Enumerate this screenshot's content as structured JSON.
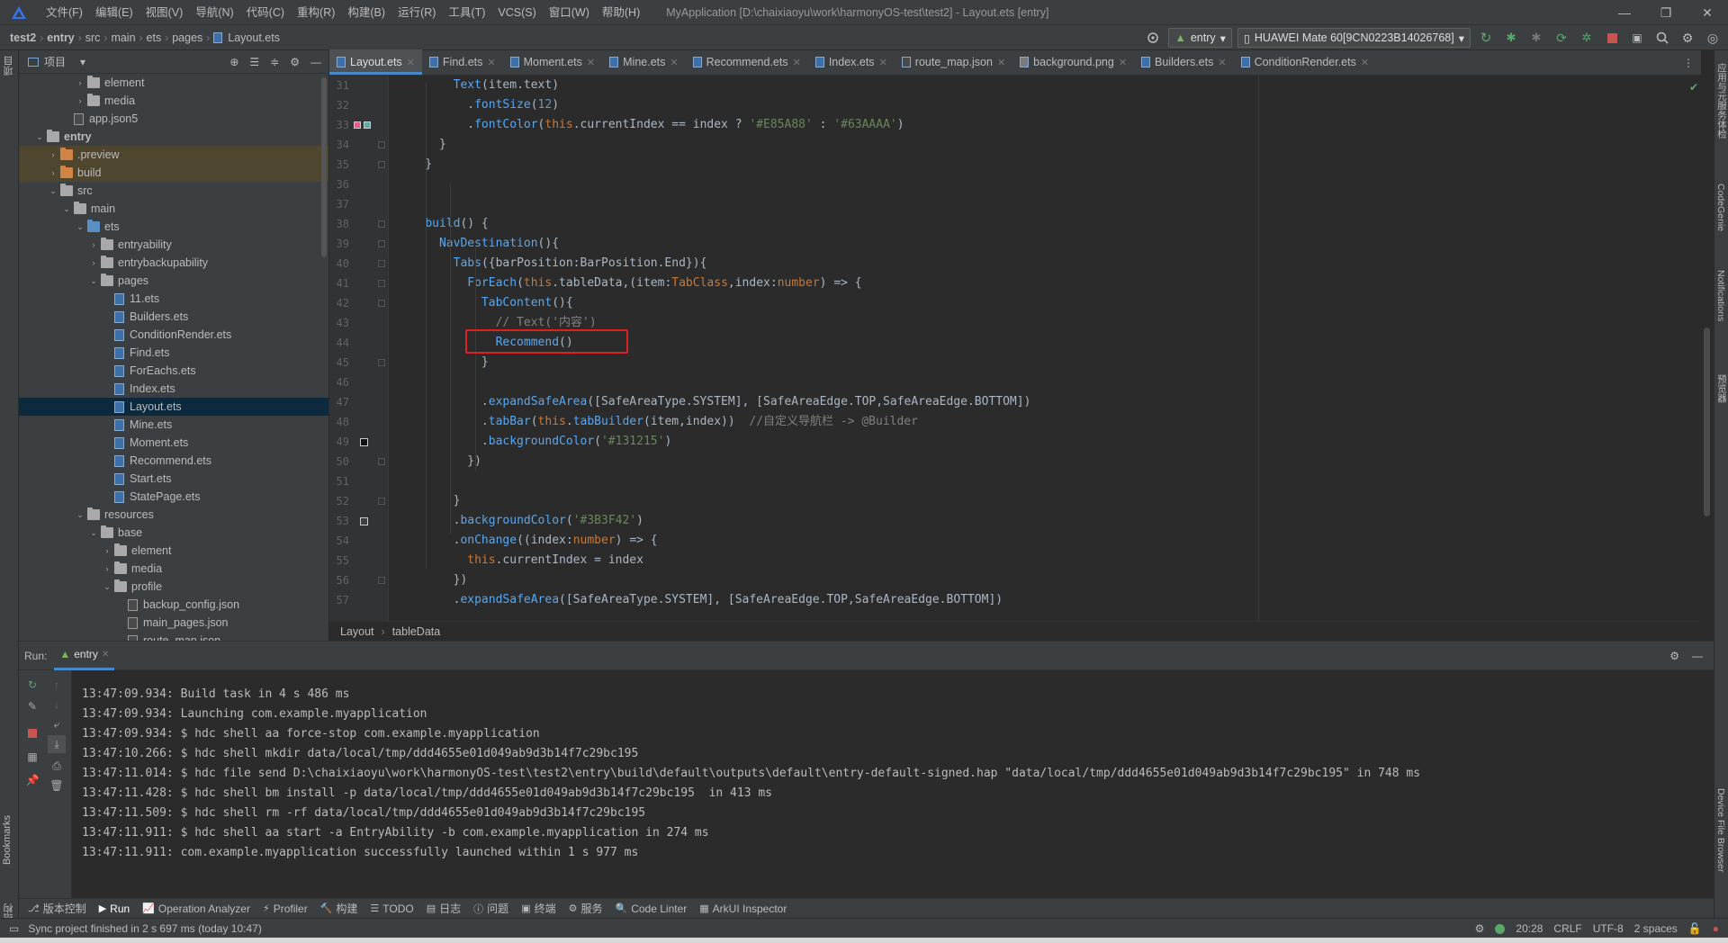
{
  "menubar": {
    "items": [
      "文件(F)",
      "编辑(E)",
      "视图(V)",
      "导航(N)",
      "代码(C)",
      "重构(R)",
      "构建(B)",
      "运行(R)",
      "工具(T)",
      "VCS(S)",
      "窗口(W)",
      "帮助(H)"
    ],
    "window_title": "MyApplication [D:\\chaixiaoyu\\work\\harmonyOS-test\\test2] - Layout.ets [entry]"
  },
  "navbar": {
    "breadcrumbs": [
      "test2",
      "entry",
      "src",
      "main",
      "ets",
      "pages",
      "Layout.ets"
    ],
    "run_config": "entry",
    "device": "HUAWEI Mate 60[9CN0223B14026768]"
  },
  "left_strip": {
    "project_label": "项目",
    "bookmarks_label": "Bookmarks",
    "structure_label": "结构"
  },
  "project": {
    "header_label": "项目",
    "tree": [
      {
        "label": "element",
        "depth": 4,
        "type": "folder",
        "arrow": "›"
      },
      {
        "label": "media",
        "depth": 4,
        "type": "folder",
        "arrow": "›"
      },
      {
        "label": "app.json5",
        "depth": 3,
        "type": "json",
        "arrow": ""
      },
      {
        "label": "entry",
        "depth": 1,
        "type": "folder-mod",
        "arrow": "⌄",
        "bold": true
      },
      {
        "label": ".preview",
        "depth": 2,
        "type": "folder-orange",
        "arrow": "›",
        "excluded": true
      },
      {
        "label": "build",
        "depth": 2,
        "type": "folder-orange",
        "arrow": "›",
        "excluded": true
      },
      {
        "label": "src",
        "depth": 2,
        "type": "folder",
        "arrow": "⌄"
      },
      {
        "label": "main",
        "depth": 3,
        "type": "folder",
        "arrow": "⌄"
      },
      {
        "label": "ets",
        "depth": 4,
        "type": "folder-blue",
        "arrow": "⌄"
      },
      {
        "label": "entryability",
        "depth": 5,
        "type": "folder",
        "arrow": "›"
      },
      {
        "label": "entrybackupability",
        "depth": 5,
        "type": "folder",
        "arrow": "›"
      },
      {
        "label": "pages",
        "depth": 5,
        "type": "folder",
        "arrow": "⌄"
      },
      {
        "label": "11.ets",
        "depth": 6,
        "type": "file",
        "arrow": ""
      },
      {
        "label": "Builders.ets",
        "depth": 6,
        "type": "file",
        "arrow": ""
      },
      {
        "label": "ConditionRender.ets",
        "depth": 6,
        "type": "file",
        "arrow": ""
      },
      {
        "label": "Find.ets",
        "depth": 6,
        "type": "file",
        "arrow": ""
      },
      {
        "label": "ForEachs.ets",
        "depth": 6,
        "type": "file",
        "arrow": ""
      },
      {
        "label": "Index.ets",
        "depth": 6,
        "type": "file",
        "arrow": ""
      },
      {
        "label": "Layout.ets",
        "depth": 6,
        "type": "file",
        "arrow": "",
        "selected": true
      },
      {
        "label": "Mine.ets",
        "depth": 6,
        "type": "file",
        "arrow": ""
      },
      {
        "label": "Moment.ets",
        "depth": 6,
        "type": "file",
        "arrow": ""
      },
      {
        "label": "Recommend.ets",
        "depth": 6,
        "type": "file",
        "arrow": ""
      },
      {
        "label": "Start.ets",
        "depth": 6,
        "type": "file",
        "arrow": ""
      },
      {
        "label": "StatePage.ets",
        "depth": 6,
        "type": "file",
        "arrow": ""
      },
      {
        "label": "resources",
        "depth": 4,
        "type": "folder",
        "arrow": "⌄"
      },
      {
        "label": "base",
        "depth": 5,
        "type": "folder",
        "arrow": "⌄"
      },
      {
        "label": "element",
        "depth": 6,
        "type": "folder",
        "arrow": "›"
      },
      {
        "label": "media",
        "depth": 6,
        "type": "folder",
        "arrow": "›"
      },
      {
        "label": "profile",
        "depth": 6,
        "type": "folder",
        "arrow": "⌄"
      },
      {
        "label": "backup_config.json",
        "depth": 7,
        "type": "json",
        "arrow": ""
      },
      {
        "label": "main_pages.json",
        "depth": 7,
        "type": "json",
        "arrow": ""
      },
      {
        "label": "route_map.json",
        "depth": 7,
        "type": "json",
        "arrow": ""
      }
    ]
  },
  "editor": {
    "tabs": [
      {
        "label": "Layout.ets",
        "active": true
      },
      {
        "label": "Find.ets"
      },
      {
        "label": "Moment.ets"
      },
      {
        "label": "Mine.ets"
      },
      {
        "label": "Recommend.ets"
      },
      {
        "label": "Index.ets"
      },
      {
        "label": "route_map.json"
      },
      {
        "label": "background.png"
      },
      {
        "label": "Builders.ets"
      },
      {
        "label": "ConditionRender.ets"
      }
    ],
    "code": [
      {
        "no": "31",
        "tokens": [
          [
            "",
            "        "
          ],
          [
            "fn",
            "Text"
          ],
          [
            "",
            "(item.text)"
          ]
        ]
      },
      {
        "no": "32",
        "tokens": [
          [
            "",
            "          ."
          ],
          [
            "fn",
            "fontSize"
          ],
          [
            "",
            "("
          ],
          [
            "n",
            "12"
          ],
          [
            "",
            ")"
          ]
        ]
      },
      {
        "no": "33",
        "tokens": [
          [
            "",
            "          ."
          ],
          [
            "fn",
            "fontColor"
          ],
          [
            "",
            "("
          ],
          [
            "k",
            "this"
          ],
          [
            "",
            ".currentIndex == index ? "
          ],
          [
            "s",
            "'#E85A88'"
          ],
          [
            "",
            " : "
          ],
          [
            "s",
            "'#63AAAA'"
          ],
          [
            "",
            ")"
          ]
        ]
      },
      {
        "no": "34",
        "tokens": [
          [
            "",
            "      }"
          ]
        ]
      },
      {
        "no": "35",
        "tokens": [
          [
            "",
            "    }"
          ]
        ]
      },
      {
        "no": "36",
        "tokens": [
          [
            "",
            ""
          ]
        ]
      },
      {
        "no": "37",
        "tokens": [
          [
            "",
            ""
          ]
        ]
      },
      {
        "no": "38",
        "tokens": [
          [
            "",
            "    "
          ],
          [
            "fn",
            "build"
          ],
          [
            "",
            "() {"
          ]
        ]
      },
      {
        "no": "39",
        "tokens": [
          [
            "",
            "      "
          ],
          [
            "fn",
            "NavDestination"
          ],
          [
            "",
            "(){"
          ]
        ]
      },
      {
        "no": "40",
        "tokens": [
          [
            "",
            "        "
          ],
          [
            "fn",
            "Tabs"
          ],
          [
            "",
            "({barPosition:BarPosition.End}){"
          ]
        ]
      },
      {
        "no": "41",
        "tokens": [
          [
            "",
            "          "
          ],
          [
            "fn",
            "ForEach"
          ],
          [
            "",
            "("
          ],
          [
            "k",
            "this"
          ],
          [
            "",
            ".tableData,(item:"
          ],
          [
            "k",
            "TabClass"
          ],
          [
            "",
            ",index:"
          ],
          [
            "k",
            "number"
          ],
          [
            "",
            ") => {"
          ]
        ]
      },
      {
        "no": "42",
        "tokens": [
          [
            "",
            "            "
          ],
          [
            "fn",
            "TabContent"
          ],
          [
            "",
            "(){"
          ]
        ]
      },
      {
        "no": "43",
        "tokens": [
          [
            "",
            "              "
          ],
          [
            "c",
            "// Text('内容')"
          ]
        ]
      },
      {
        "no": "44",
        "tokens": [
          [
            "",
            "              "
          ],
          [
            "fn",
            "Recommend"
          ],
          [
            "",
            "()"
          ]
        ]
      },
      {
        "no": "45",
        "tokens": [
          [
            "",
            "            }"
          ]
        ]
      },
      {
        "no": "46",
        "tokens": [
          [
            "",
            ""
          ]
        ]
      },
      {
        "no": "47",
        "tokens": [
          [
            "",
            "            ."
          ],
          [
            "fn",
            "expandSafeArea"
          ],
          [
            "",
            "([SafeAreaType.SYSTEM], [SafeAreaEdge.TOP,SafeAreaEdge.BOTTOM])"
          ]
        ]
      },
      {
        "no": "48",
        "tokens": [
          [
            "",
            "            ."
          ],
          [
            "fn",
            "tabBar"
          ],
          [
            "",
            "("
          ],
          [
            "k",
            "this"
          ],
          [
            "",
            "."
          ],
          [
            "fn",
            "tabBuilder"
          ],
          [
            "",
            "(item,index))  "
          ],
          [
            "c",
            "//自定义导航栏 -> @Builder"
          ]
        ]
      },
      {
        "no": "49",
        "tokens": [
          [
            "",
            "            ."
          ],
          [
            "fn",
            "backgroundColor"
          ],
          [
            "",
            "("
          ],
          [
            "s",
            "'#131215'"
          ],
          [
            "",
            ")"
          ]
        ]
      },
      {
        "no": "50",
        "tokens": [
          [
            "",
            "          })"
          ]
        ]
      },
      {
        "no": "51",
        "tokens": [
          [
            "",
            ""
          ]
        ]
      },
      {
        "no": "52",
        "tokens": [
          [
            "",
            "        }"
          ]
        ]
      },
      {
        "no": "53",
        "tokens": [
          [
            "",
            "        ."
          ],
          [
            "fn",
            "backgroundColor"
          ],
          [
            "",
            "("
          ],
          [
            "s",
            "'#3B3F42'"
          ],
          [
            "",
            ")"
          ]
        ]
      },
      {
        "no": "54",
        "tokens": [
          [
            "",
            "        ."
          ],
          [
            "fn",
            "onChange"
          ],
          [
            "",
            "((index:"
          ],
          [
            "k",
            "number"
          ],
          [
            "",
            ") => {"
          ]
        ]
      },
      {
        "no": "55",
        "tokens": [
          [
            "",
            "          "
          ],
          [
            "k",
            "this"
          ],
          [
            "",
            ".currentIndex = index"
          ]
        ]
      },
      {
        "no": "56",
        "tokens": [
          [
            "",
            "        })"
          ]
        ]
      },
      {
        "no": "57",
        "tokens": [
          [
            "",
            "        ."
          ],
          [
            "fn",
            "expandSafeArea"
          ],
          [
            "",
            "([SafeAreaType.SYSTEM], [SafeAreaEdge.TOP,SafeAreaEdge.BOTTOM])"
          ]
        ]
      }
    ],
    "breadcrumb": [
      "Layout",
      "tableData"
    ]
  },
  "right_strip": {
    "labels": [
      "应用与元服务体检",
      "CodeGenie",
      "Notifications",
      "预览器",
      "Device File Browser"
    ]
  },
  "run": {
    "label": "Run:",
    "tab": "entry",
    "console": [
      "13:47:09.934: Build task in 4 s 486 ms",
      "13:47:09.934: Launching com.example.myapplication",
      "13:47:09.934: $ hdc shell aa force-stop com.example.myapplication",
      "13:47:10.266: $ hdc shell mkdir data/local/tmp/ddd4655e01d049ab9d3b14f7c29bc195",
      "13:47:11.014: $ hdc file send D:\\chaixiaoyu\\work\\harmonyOS-test\\test2\\entry\\build\\default\\outputs\\default\\entry-default-signed.hap \"data/local/tmp/ddd4655e01d049ab9d3b14f7c29bc195\" in 748 ms",
      "13:47:11.428: $ hdc shell bm install -p data/local/tmp/ddd4655e01d049ab9d3b14f7c29bc195  in 413 ms",
      "13:47:11.509: $ hdc shell rm -rf data/local/tmp/ddd4655e01d049ab9d3b14f7c29bc195",
      "13:47:11.911: $ hdc shell aa start -a EntryAbility -b com.example.myapplication in 274 ms",
      "13:47:11.911: com.example.myapplication successfully launched within 1 s 977 ms"
    ]
  },
  "bottom_tools": [
    "版本控制",
    "Run",
    "Operation Analyzer",
    "Profiler",
    "构建",
    "TODO",
    "日志",
    "问题",
    "终端",
    "服务",
    "Code Linter",
    "ArkUI Inspector"
  ],
  "status": {
    "message": "Sync project finished in 2 s 697 ms (today 10:47)",
    "position": "20:28",
    "line_sep": "CRLF",
    "encoding": "UTF-8",
    "indent": "2 spaces"
  },
  "colors": {
    "accent": "#4a88c7",
    "highlight_box": "#e02020",
    "selected_row": "#0d293e"
  }
}
